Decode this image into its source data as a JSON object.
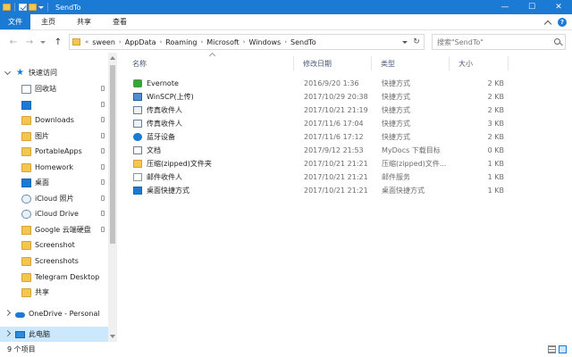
{
  "window": {
    "title": "SendTo",
    "buttons": {
      "minimize": "—",
      "maximize": "☐",
      "close": "✕"
    }
  },
  "ribbon": {
    "tabs": [
      {
        "label": "文件",
        "active": true
      },
      {
        "label": "主页",
        "active": false
      },
      {
        "label": "共享",
        "active": false
      },
      {
        "label": "查看",
        "active": false
      }
    ],
    "help": "?"
  },
  "address": {
    "back": "←",
    "forward": "→",
    "up": "↑",
    "overflow": "«",
    "crumbs": [
      "sween",
      "AppData",
      "Roaming",
      "Microsoft",
      "Windows",
      "SendTo"
    ],
    "separator": "›",
    "refresh": "↻",
    "search_placeholder": "搜索\"SendTo\""
  },
  "sidebar": {
    "items": [
      {
        "label": "快速访问",
        "icon": "star-icon",
        "pinned": false
      },
      {
        "label": "回收站",
        "icon": "recycle-bin-icon",
        "pinned": true
      },
      {
        "label": "",
        "icon": "desktop-icon",
        "pinned": true
      },
      {
        "label": "Downloads",
        "icon": "folder-icon",
        "pinned": true
      },
      {
        "label": "图片",
        "icon": "folder-icon",
        "pinned": true
      },
      {
        "label": "PortableApps",
        "icon": "folder-icon",
        "pinned": true
      },
      {
        "label": "Homework",
        "icon": "folder-icon",
        "pinned": true
      },
      {
        "label": "桌面",
        "icon": "desktop-icon",
        "pinned": true
      },
      {
        "label": "iCloud 照片",
        "icon": "cloud-icon",
        "pinned": true
      },
      {
        "label": "iCloud Drive",
        "icon": "cloud-icon",
        "pinned": true
      },
      {
        "label": "Google 云端硬盘",
        "icon": "google-drive-icon",
        "pinned": true
      },
      {
        "label": "Screenshot",
        "icon": "folder-icon",
        "pinned": false
      },
      {
        "label": "Screenshots",
        "icon": "folder-icon",
        "pinned": false
      },
      {
        "label": "Telegram Desktop",
        "icon": "folder-icon",
        "pinned": false
      },
      {
        "label": "共享",
        "icon": "folder-icon",
        "pinned": false
      },
      {
        "label": "OneDrive - Personal",
        "icon": "onedrive-icon",
        "pinned": false
      },
      {
        "label": "此电脑",
        "icon": "computer-icon",
        "pinned": false,
        "selected": true
      }
    ]
  },
  "columns": {
    "name": "名称",
    "date": "修改日期",
    "type": "类型",
    "size": "大小"
  },
  "files": [
    {
      "name": "Evernote",
      "date": "2016/9/20 1:36",
      "type": "快捷方式",
      "size": "2 KB",
      "icon": "evernote-icon"
    },
    {
      "name": "WinSCP(上传)",
      "date": "2017/10/29 20:38",
      "type": "快捷方式",
      "size": "2 KB",
      "icon": "winscp-icon"
    },
    {
      "name": "传真收件人",
      "date": "2017/10/21 21:19",
      "type": "快捷方式",
      "size": "2 KB",
      "icon": "fax-icon"
    },
    {
      "name": "传真收件人",
      "date": "2017/11/6 17:04",
      "type": "快捷方式",
      "size": "3 KB",
      "icon": "fax-icon"
    },
    {
      "name": "蓝牙设备",
      "date": "2017/11/6 17:12",
      "type": "快捷方式",
      "size": "2 KB",
      "icon": "bluetooth-icon"
    },
    {
      "name": "文档",
      "date": "2017/9/12 21:53",
      "type": "MyDocs 下载目标",
      "size": "0 KB",
      "icon": "document-icon"
    },
    {
      "name": "压缩(zipped)文件夹",
      "date": "2017/10/21 21:21",
      "type": "压缩(zipped)文件...",
      "size": "1 KB",
      "icon": "zip-folder-icon"
    },
    {
      "name": "邮件收件人",
      "date": "2017/10/21 21:21",
      "type": "邮件服务",
      "size": "1 KB",
      "icon": "mail-icon"
    },
    {
      "name": "桌面快捷方式",
      "date": "2017/10/21 21:21",
      "type": "桌面快捷方式",
      "size": "1 KB",
      "icon": "desktop-shortcut-icon"
    }
  ],
  "status": {
    "count": "9 个项目"
  }
}
